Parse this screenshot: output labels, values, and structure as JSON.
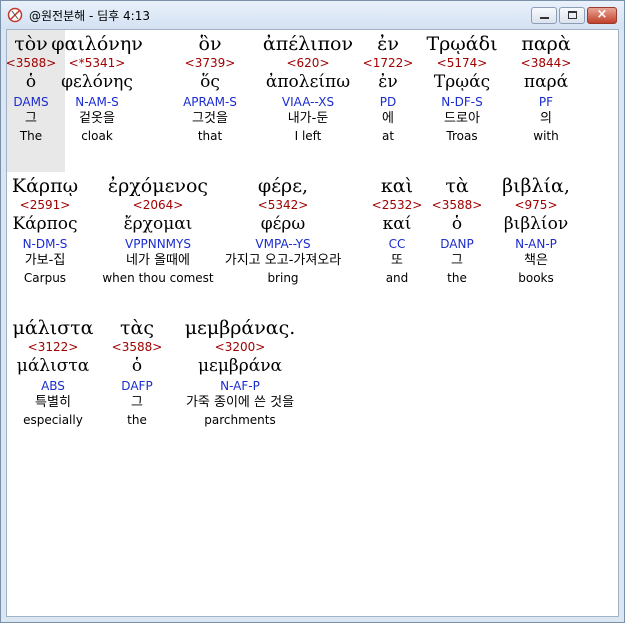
{
  "window": {
    "title": "@원전분해 - 딤후 4:13",
    "controls": {
      "minimize_icon": "minimize-icon",
      "maximize_icon": "maximize-icon",
      "close_icon": "close-icon",
      "close_glyph": "×"
    }
  },
  "rows": [
    [
      {
        "greek": "τὸν",
        "strong": "<3588>",
        "lemma": "ὁ",
        "parse": "DAMS",
        "korean": "그",
        "english": "The"
      },
      {
        "greek": "φαιλόνην",
        "strong": "<*5341>",
        "lemma": "φελόνης",
        "parse": "N-AM-S",
        "korean": "겉옷을",
        "english": "cloak"
      },
      {
        "greek": "ὃν",
        "strong": "<3739>",
        "lemma": "ὅς",
        "parse": "APRAM-S",
        "korean": "그것을",
        "english": "that"
      },
      {
        "greek": "ἀπέλιπον",
        "strong": "<620>",
        "lemma": "ἀπολείπω",
        "parse": "VIAA--XS",
        "korean": "내가-둔",
        "english": "I left"
      },
      {
        "greek": "ἐν",
        "strong": "<1722>",
        "lemma": "ἐν",
        "parse": "PD",
        "korean": "에",
        "english": "at"
      },
      {
        "greek": "Τρῳάδι",
        "strong": "<5174>",
        "lemma": "Τρῳάς",
        "parse": "N-DF-S",
        "korean": "드로아",
        "english": "Troas"
      },
      {
        "greek": "παρὰ",
        "strong": "<3844>",
        "lemma": "παρά",
        "parse": "PF",
        "korean": "의",
        "english": "with"
      }
    ],
    [
      {
        "greek": "Κάρπῳ",
        "strong": "<2591>",
        "lemma": "Κάρπος",
        "parse": "N-DM-S",
        "korean": "가보-집",
        "english": "Carpus"
      },
      {
        "greek": "ἐρχόμενος",
        "strong": "<2064>",
        "lemma": "ἔρχομαι",
        "parse": "VPPNNMYS",
        "korean": "네가 올때에",
        "english": "when thou comest"
      },
      {
        "greek": "φέρε,",
        "strong": "<5342>",
        "lemma": "φέρω",
        "parse": "VMPA--YS",
        "korean": "가지고 오고-가져오라",
        "english": "bring"
      },
      {
        "greek": "καὶ",
        "strong": "<2532>",
        "lemma": "καί",
        "parse": "CC",
        "korean": "또",
        "english": "and"
      },
      {
        "greek": "τὰ",
        "strong": "<3588>",
        "lemma": "ὁ",
        "parse": "DANP",
        "korean": "그",
        "english": "the"
      },
      {
        "greek": "βιβλία,",
        "strong": "<975>",
        "lemma": "βιβλίον",
        "parse": "N-AN-P",
        "korean": "책은",
        "english": "books"
      }
    ],
    [
      {
        "greek": "μάλιστα",
        "strong": "<3122>",
        "lemma": "μάλιστα",
        "parse": "ABS",
        "korean": "특별히",
        "english": "especially"
      },
      {
        "greek": "τὰς",
        "strong": "<3588>",
        "lemma": "ὁ",
        "parse": "DAFP",
        "korean": "그",
        "english": "the"
      },
      {
        "greek": "μεμβράνας.",
        "strong": "<3200>",
        "lemma": "μεμβράνα",
        "parse": "N-AF-P",
        "korean": "가죽 종이에 쓴 것을",
        "english": "parchments"
      }
    ]
  ]
}
